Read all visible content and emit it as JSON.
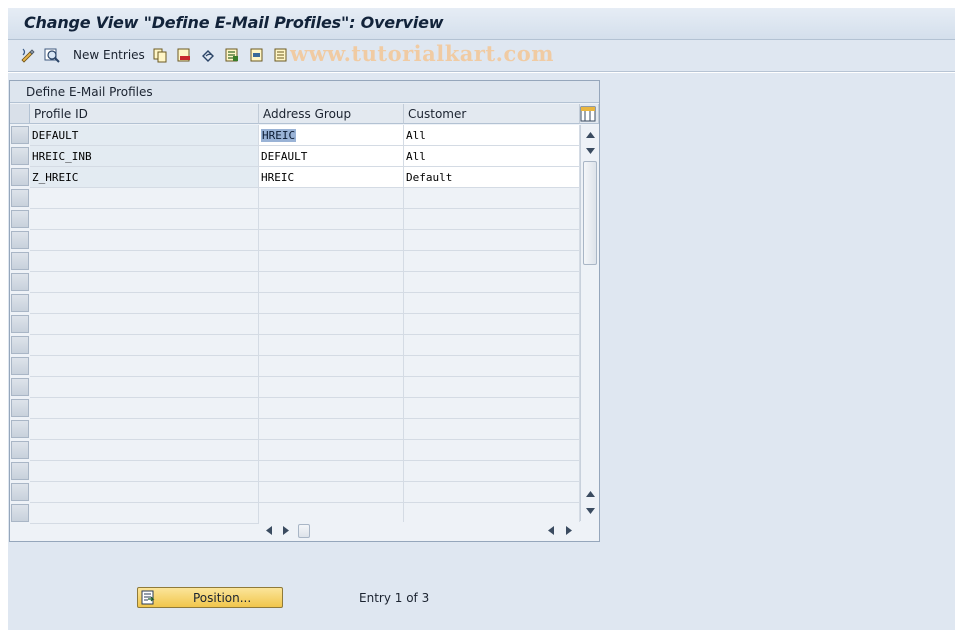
{
  "title": "Change View \"Define E-Mail Profiles\": Overview",
  "toolbar": {
    "new_entries_label": "New Entries",
    "watermark": "www.tutorialkart.com",
    "icons": [
      "display-change-icon",
      "other-view-icon",
      "copy-as-icon",
      "delete-icon",
      "undo-change-icon",
      "select-all-icon",
      "select-block-icon",
      "deselect-all-icon"
    ]
  },
  "table": {
    "title": "Define E-Mail Profiles",
    "columns": [
      "Profile ID",
      "Address Group",
      "Customer"
    ],
    "rows": [
      {
        "profile_id": "DEFAULT",
        "address_group": "HREIC",
        "customer": "All"
      },
      {
        "profile_id": "HREIC_INB",
        "address_group": "DEFAULT",
        "customer": "All"
      },
      {
        "profile_id": "Z_HREIC",
        "address_group": "HREIC",
        "customer": "Default"
      }
    ]
  },
  "footer": {
    "position_button_label": "Position...",
    "entry_text": "Entry 1 of 3"
  },
  "colors": {
    "accent": "#f1c64c",
    "selection": "#9ab3d6"
  }
}
